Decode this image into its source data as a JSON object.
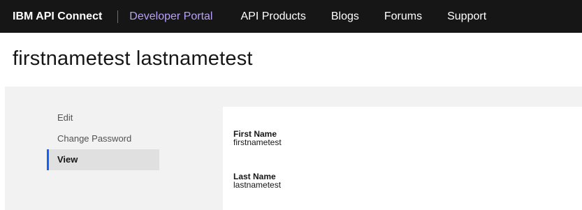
{
  "header": {
    "brand": "IBM API Connect",
    "nav": [
      "Developer Portal",
      "API Products",
      "Blogs",
      "Forums",
      "Support"
    ],
    "active_nav": "Developer Portal"
  },
  "page": {
    "title": "firstnametest lastnametest"
  },
  "sidebar": {
    "items": [
      {
        "label": "Edit",
        "selected": false
      },
      {
        "label": "Change Password",
        "selected": false
      },
      {
        "label": "View",
        "selected": true
      }
    ]
  },
  "profile": {
    "fields": [
      {
        "label": "First Name",
        "value": "firstnametest"
      },
      {
        "label": "Last Name",
        "value": "lastnametest"
      }
    ]
  },
  "colors": {
    "header_bg": "#161616",
    "active_nav": "#b8a1f8",
    "selected_accent": "#0f62fe",
    "content_bg": "#f2f2f2"
  }
}
